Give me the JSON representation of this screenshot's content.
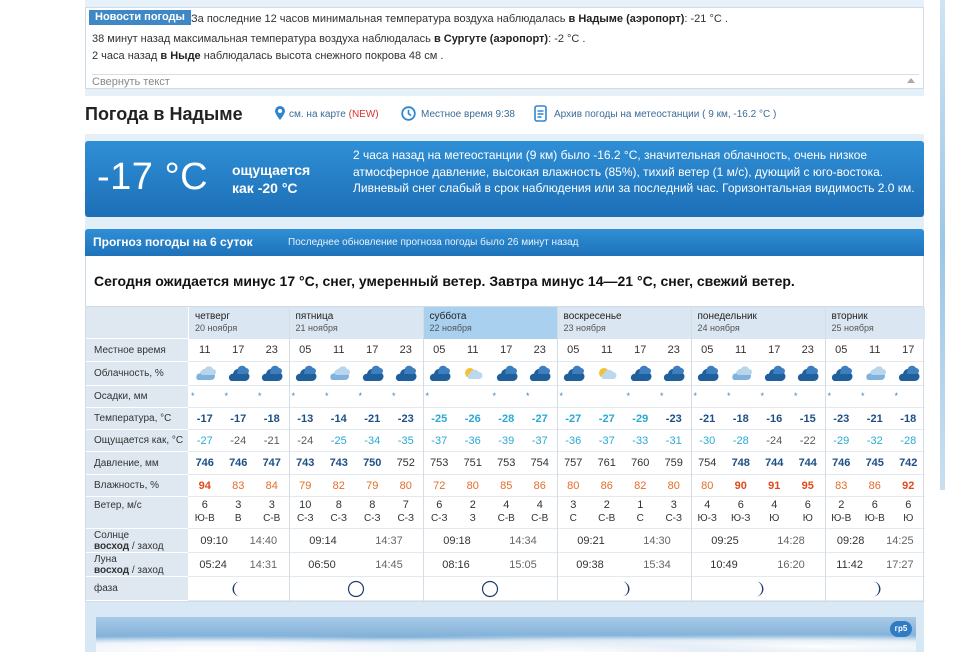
{
  "news": {
    "tab": "Новости погоды",
    "lines": [
      {
        "pre": "За последние 12 часов минимальная температура воздуха наблюдалась ",
        "place": "в Надыме (аэропорт)",
        "post": ": -21 °С ."
      },
      {
        "pre": "38 минут назад максимальная температура воздуха наблюдалась ",
        "place": "в Сургуте (аэропорт)",
        "post": ": -2 °С ."
      },
      {
        "pre": "2 часа назад ",
        "place": "в Ныде",
        "post": " наблюдалась высота снежного покрова 48 см ."
      }
    ],
    "collapse": "Свернуть текст"
  },
  "header": {
    "title": "Погода в Надыме",
    "map_link": "см. на карте",
    "new_badge": "(NEW)",
    "local_time": "Местное время  9:38",
    "archive": "Архив погоды на метеостанции  ( 9 км, -16.2 °С )"
  },
  "current": {
    "temp": "-17 °C",
    "feels_line1": "ощущается",
    "feels_line2": "как -20 °C",
    "description": "2 часа назад на метеостанции (9 км) было -16.2 °С, значительная облачность, очень низкое атмосферное давление, высокая влажность (85%), тихий ветер (1 м/с), дующий с юго-востока. Ливневый снег слабый в срок наблюдения или за последний час. Горизонтальная видимость 2.0 км."
  },
  "forecast": {
    "title": "Прогноз погоды на 6 суток",
    "updated": "Последнее обновление прогноза погоды было 26 минут назад",
    "summary": "Сегодня ожидается минус 17 °С, снег, умеренный ветер. Завтра минус 14—21 °С, снег, свежий ветер.",
    "labels": {
      "time": "Местное время",
      "cloud": "Облачность, %",
      "precip": "Осадки, мм",
      "temp": "Температура, °С",
      "feels": "Ощущается как, °С",
      "pressure": "Давление, мм",
      "humidity": "Влажность, %",
      "wind": "Ветер, м/с",
      "sun1": "Солнце",
      "sun2": "восход / заход",
      "moon1": "Луна",
      "moon2": "восход / заход",
      "phase": "фаза"
    },
    "days": [
      {
        "name": "четверг",
        "date": "20 ноября",
        "times": [
          "11",
          "17",
          "23"
        ],
        "temps": [
          "-17",
          "-17",
          "-18"
        ],
        "feels": [
          "-27",
          "-24",
          "-21"
        ],
        "pressure": [
          "746",
          "746",
          "747"
        ],
        "humidity": [
          "94",
          "83",
          "84"
        ],
        "wind": [
          "6",
          "3",
          "3"
        ],
        "dir": [
          "Ю-В",
          "В",
          "С-В"
        ],
        "sunrise": "09:10",
        "sunset": "14:40",
        "moonrise": "05:24",
        "moonset": "14:31",
        "phase": "waning-crescent"
      },
      {
        "name": "пятница",
        "date": "21 ноября",
        "times": [
          "05",
          "11",
          "17",
          "23"
        ],
        "temps": [
          "-13",
          "-14",
          "-21",
          "-23"
        ],
        "feels": [
          "-24",
          "-25",
          "-34",
          "-35"
        ],
        "pressure": [
          "743",
          "743",
          "750",
          "752"
        ],
        "humidity": [
          "79",
          "82",
          "79",
          "80"
        ],
        "wind": [
          "10",
          "8",
          "8",
          "7"
        ],
        "dir": [
          "С-З",
          "С-З",
          "С-З",
          "С-З"
        ],
        "sunrise": "09:14",
        "sunset": "14:37",
        "moonrise": "06:50",
        "moonset": "14:45",
        "phase": "new-moon"
      },
      {
        "name": "суббота",
        "date": "22 ноября",
        "times": [
          "05",
          "11",
          "17",
          "23"
        ],
        "temps": [
          "-25",
          "-26",
          "-28",
          "-27"
        ],
        "feels": [
          "-37",
          "-36",
          "-39",
          "-37"
        ],
        "pressure": [
          "753",
          "751",
          "753",
          "754"
        ],
        "humidity": [
          "72",
          "80",
          "85",
          "86"
        ],
        "wind": [
          "6",
          "2",
          "4",
          "4"
        ],
        "dir": [
          "С-З",
          "З",
          "С-В",
          "С-В"
        ],
        "sunrise": "09:18",
        "sunset": "14:34",
        "moonrise": "08:16",
        "moonset": "15:05",
        "phase": "new-moon"
      },
      {
        "name": "воскресенье",
        "date": "23 ноября",
        "times": [
          "05",
          "11",
          "17",
          "23"
        ],
        "temps": [
          "-27",
          "-27",
          "-29",
          "-23"
        ],
        "feels": [
          "-36",
          "-37",
          "-33",
          "-31"
        ],
        "pressure": [
          "757",
          "761",
          "760",
          "759"
        ],
        "humidity": [
          "80",
          "86",
          "82",
          "80"
        ],
        "wind": [
          "3",
          "2",
          "1",
          "3"
        ],
        "dir": [
          "С",
          "С-В",
          "С",
          "С-З"
        ],
        "sunrise": "09:21",
        "sunset": "14:30",
        "moonrise": "09:38",
        "moonset": "15:34",
        "phase": "waxing-crescent"
      },
      {
        "name": "понедельник",
        "date": "24 ноября",
        "times": [
          "05",
          "11",
          "17",
          "23"
        ],
        "temps": [
          "-21",
          "-18",
          "-16",
          "-15"
        ],
        "feels": [
          "-30",
          "-28",
          "-24",
          "-22"
        ],
        "pressure": [
          "754",
          "748",
          "744",
          "744"
        ],
        "humidity": [
          "80",
          "90",
          "91",
          "95"
        ],
        "wind": [
          "4",
          "6",
          "4",
          "6"
        ],
        "dir": [
          "Ю-З",
          "Ю-З",
          "Ю",
          "Ю"
        ],
        "sunrise": "09:25",
        "sunset": "14:28",
        "moonrise": "10:49",
        "moonset": "16:20",
        "phase": "waxing-crescent"
      },
      {
        "name": "вторник",
        "date": "25 ноября",
        "times": [
          "05",
          "11",
          "17"
        ],
        "temps": [
          "-23",
          "-21",
          "-18"
        ],
        "feels": [
          "-29",
          "-32",
          "-28"
        ],
        "pressure": [
          "746",
          "745",
          "742"
        ],
        "humidity": [
          "83",
          "86",
          "92"
        ],
        "wind": [
          "2",
          "6",
          "6"
        ],
        "dir": [
          "Ю-В",
          "Ю-В",
          "Ю"
        ],
        "sunrise": "09:28",
        "sunset": "14:25",
        "moonrise": "11:42",
        "moonset": "17:27",
        "phase": "waxing-crescent"
      }
    ]
  },
  "logo": "гр5",
  "colors": {
    "accent": "#1e72b9",
    "saturday": "#a9d0ee",
    "cold": "#1d4f86",
    "very_cold": "#2aa9d4",
    "humidity": "#e36d2a"
  }
}
